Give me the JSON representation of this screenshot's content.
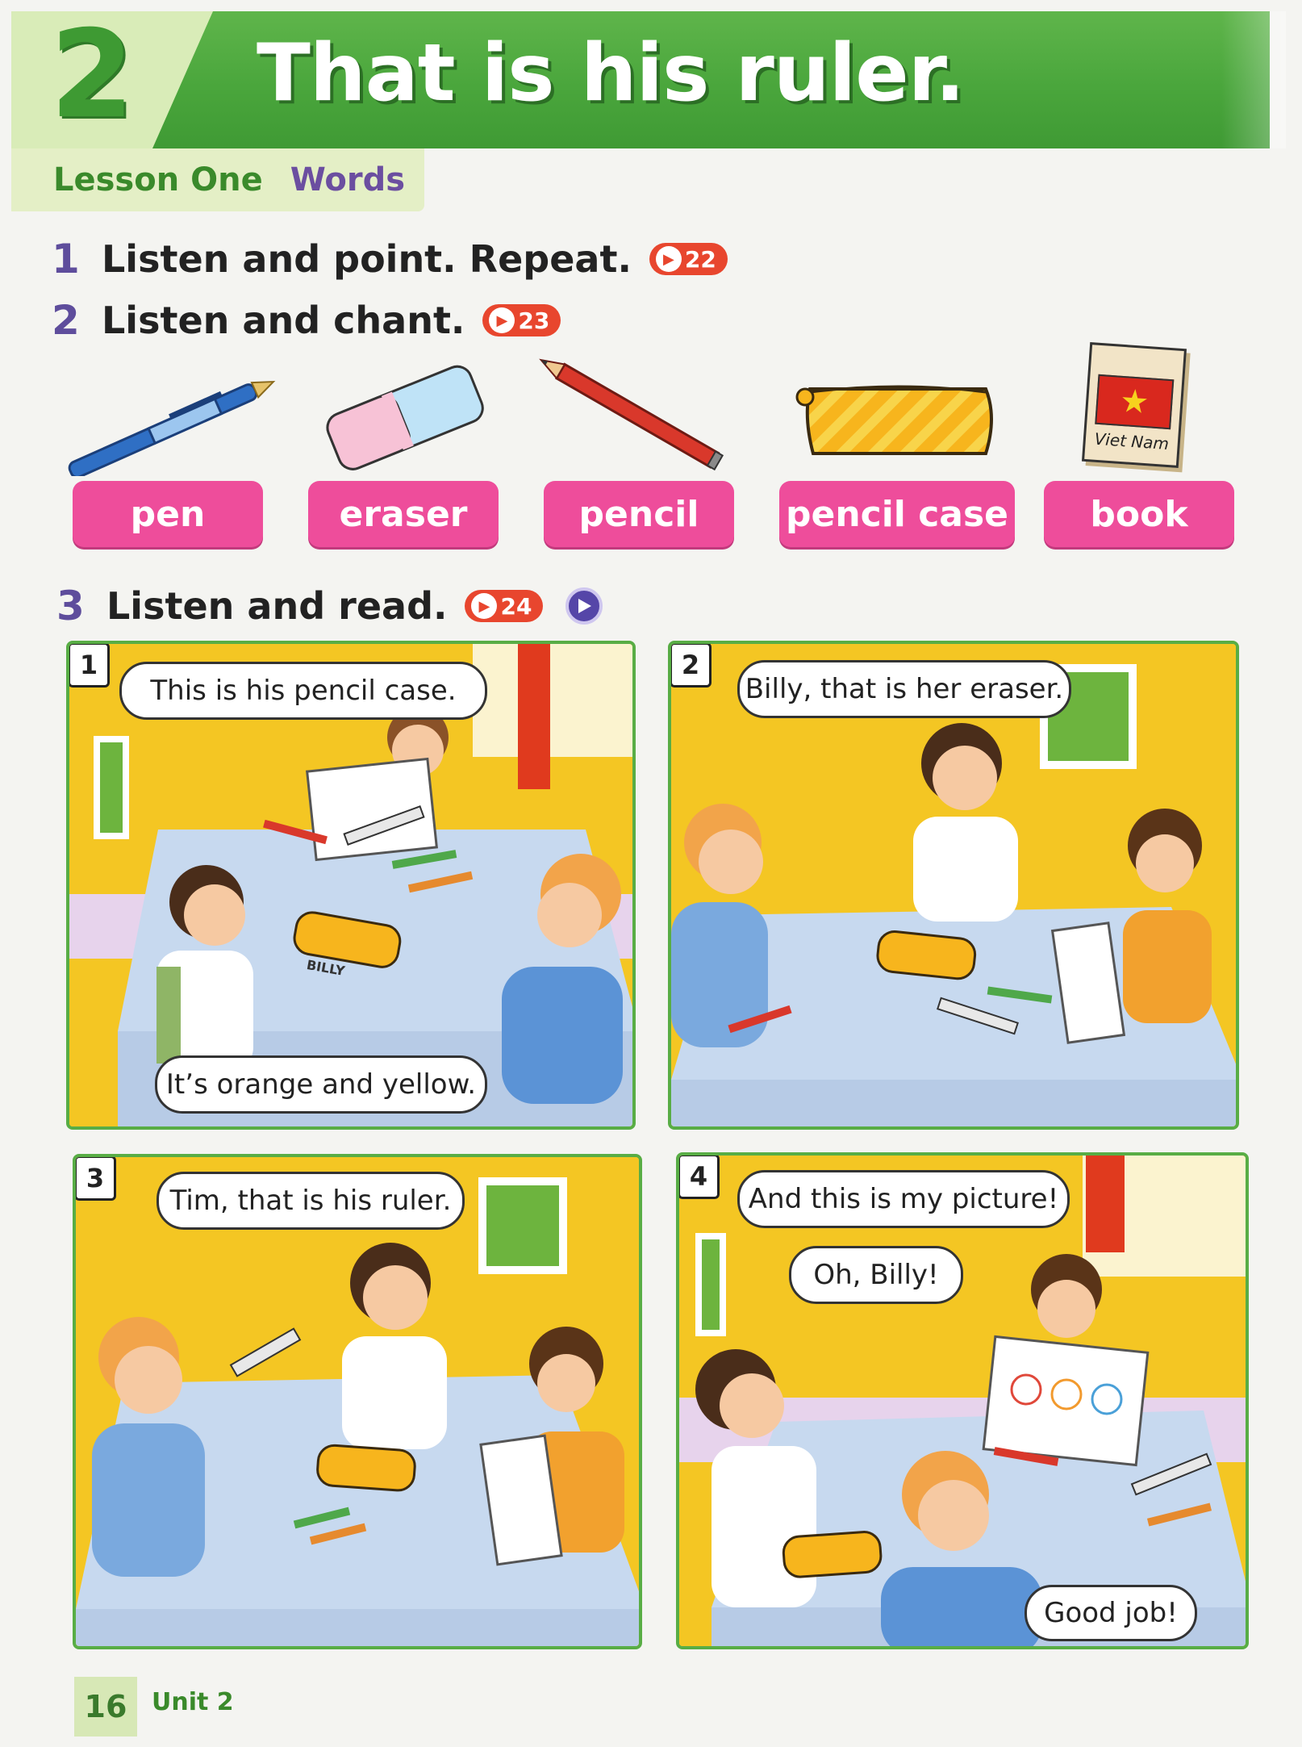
{
  "header": {
    "unit_number": "2",
    "title": "That is his ruler.",
    "lesson": "Lesson One",
    "lesson_topic": "Words"
  },
  "instructions": [
    {
      "number": "1",
      "text": "Listen and point. Repeat.",
      "audio": "22"
    },
    {
      "number": "2",
      "text": "Listen and chant.",
      "audio": "23"
    },
    {
      "number": "3",
      "text": "Listen and read.",
      "audio": "24"
    }
  ],
  "vocabulary": [
    {
      "word": "pen",
      "icon": "pen-icon"
    },
    {
      "word": "eraser",
      "icon": "eraser-icon"
    },
    {
      "word": "pencil",
      "icon": "pencil-icon"
    },
    {
      "word": "pencil case",
      "icon": "pencil-case-icon"
    },
    {
      "word": "book",
      "icon": "book-icon",
      "cover_text": "Viet Nam"
    }
  ],
  "comic": [
    {
      "number": "1",
      "bubbles": [
        "This is his pencil case.",
        "It’s orange and yellow."
      ],
      "case_label": "BILLY"
    },
    {
      "number": "2",
      "bubbles": [
        "Billy, that is her eraser."
      ]
    },
    {
      "number": "3",
      "bubbles": [
        "Tim, that is his ruler."
      ]
    },
    {
      "number": "4",
      "bubbles": [
        "And this is my picture!",
        "Oh, Billy!",
        "Good job!"
      ]
    }
  ],
  "footer": {
    "page_number": "16",
    "unit_label": "Unit 2"
  },
  "colors": {
    "header_green": "#4aa63c",
    "lesson_purple": "#6b4ea0",
    "label_pink": "#ee4d9b",
    "audio_red": "#e8462e",
    "panel_yellow": "#f5cc2e",
    "table_blue": "#c7d9ef"
  }
}
